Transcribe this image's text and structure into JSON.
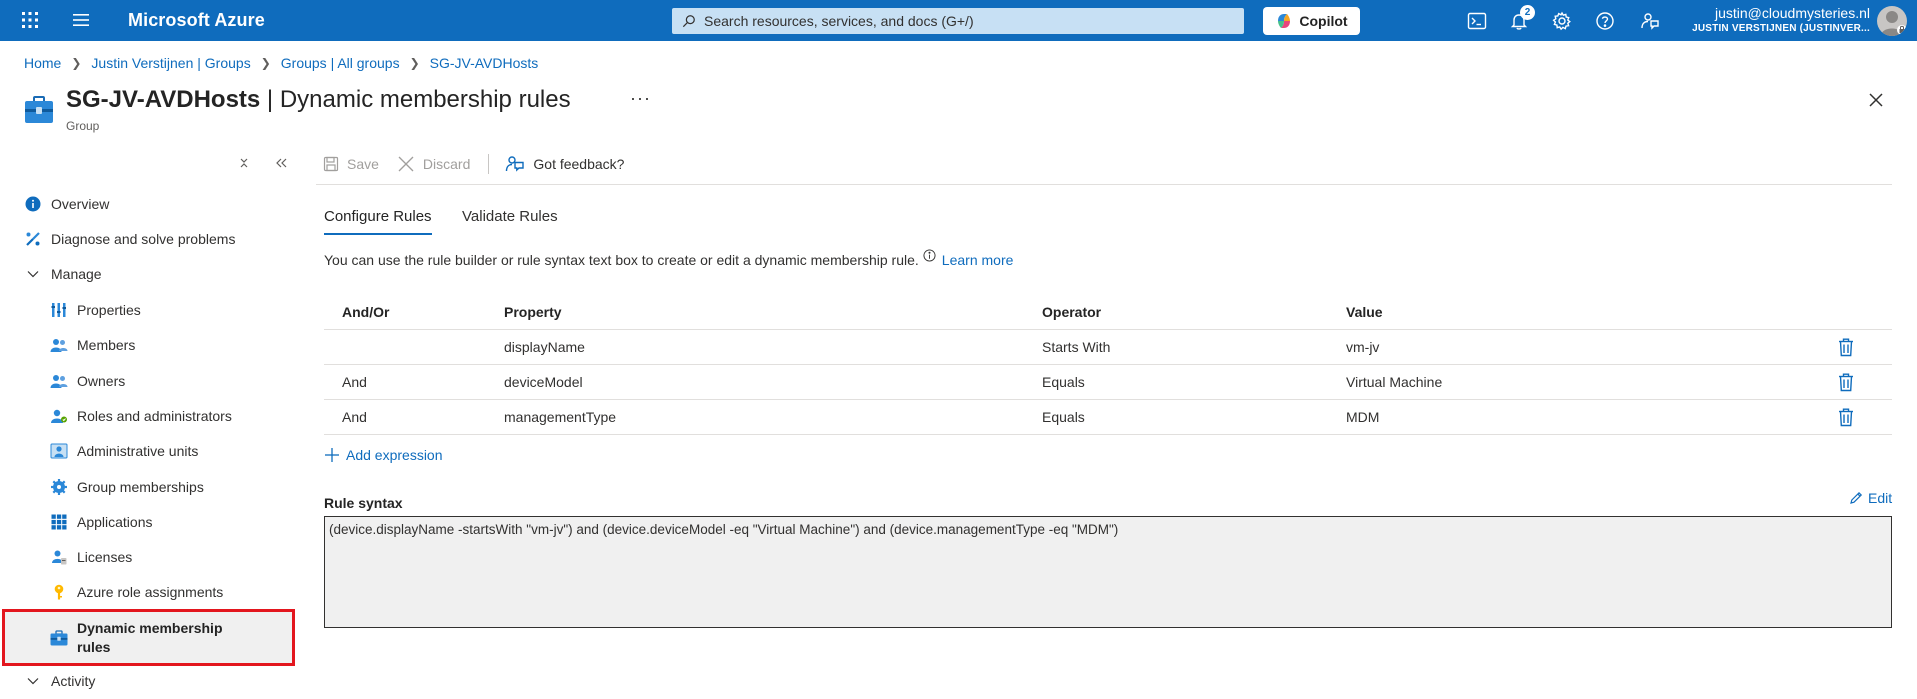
{
  "topbar": {
    "brand": "Microsoft Azure",
    "search_placeholder": "Search resources, services, and docs (G+/)",
    "copilot_label": "Copilot",
    "notifications_count": "2",
    "user_email": "justin@cloudmysteries.nl",
    "user_tenant": "JUSTIN VERSTIJNEN (JUSTINVER...",
    "accent_color": "#0f6cbd"
  },
  "breadcrumb": {
    "items": [
      "Home",
      "Justin Verstijnen | Groups",
      "Groups | All groups",
      "SG-JV-AVDHosts"
    ]
  },
  "header": {
    "title_bold": "SG-JV-AVDHosts",
    "title_rest": " | Dynamic membership rules",
    "subtitle": "Group",
    "more": "···"
  },
  "sidebar": {
    "items": [
      {
        "label": "Overview",
        "icon": "info-icon"
      },
      {
        "label": "Diagnose and solve problems",
        "icon": "wrench-icon"
      },
      {
        "label": "Manage",
        "icon": "chevron-down-icon"
      },
      {
        "label": "Properties",
        "icon": "properties-icon"
      },
      {
        "label": "Members",
        "icon": "members-icon"
      },
      {
        "label": "Owners",
        "icon": "owners-icon"
      },
      {
        "label": "Roles and administrators",
        "icon": "roles-icon"
      },
      {
        "label": "Administrative units",
        "icon": "admin-units-icon"
      },
      {
        "label": "Group memberships",
        "icon": "gear-icon"
      },
      {
        "label": "Applications",
        "icon": "grid-icon"
      },
      {
        "label": "Licenses",
        "icon": "licenses-icon"
      },
      {
        "label": "Azure role assignments",
        "icon": "key-icon"
      },
      {
        "label": "Dynamic membership rules",
        "icon": "toolbox-icon"
      },
      {
        "label": "Activity",
        "icon": "chevron-down-icon"
      }
    ],
    "highlight_color": "#e3161e"
  },
  "toolbar": {
    "save_label": "Save",
    "discard_label": "Discard",
    "feedback_label": "Got feedback?"
  },
  "tabs": [
    "Configure Rules",
    "Validate Rules"
  ],
  "description": {
    "text": "You can use the rule builder or rule syntax text box to create or edit a dynamic membership rule.",
    "link": "Learn more"
  },
  "rules": {
    "headers": [
      "And/Or",
      "Property",
      "Operator",
      "Value"
    ],
    "rows": [
      {
        "andor": "",
        "property": "displayName",
        "operator": "Starts With",
        "value": "vm-jv"
      },
      {
        "andor": "And",
        "property": "deviceModel",
        "operator": "Equals",
        "value": "Virtual Machine"
      },
      {
        "andor": "And",
        "property": "managementType",
        "operator": "Equals",
        "value": "MDM"
      }
    ],
    "add_label": "Add expression"
  },
  "rule_syntax": {
    "label": "Rule syntax",
    "edit_label": "Edit",
    "value": "(device.displayName -startsWith \"vm-jv\") and (device.deviceModel -eq \"Virtual Machine\") and (device.managementType -eq \"MDM\")"
  }
}
